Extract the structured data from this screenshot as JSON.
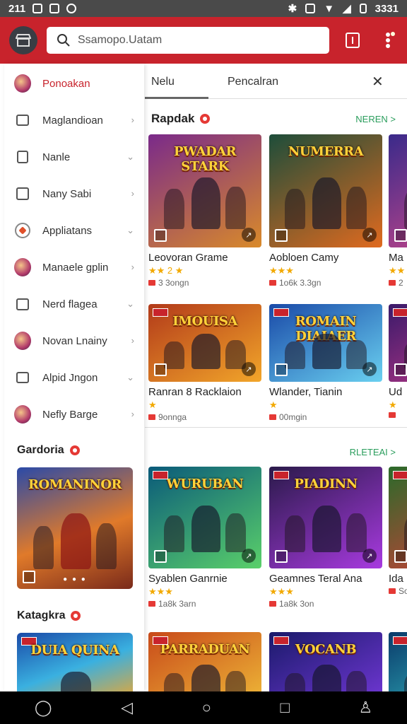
{
  "status_bar": {
    "time": "211",
    "right_text": "3331"
  },
  "app_bar": {
    "search_text": "Ssamopo.Uatam"
  },
  "drawer": {
    "items": [
      {
        "label": "Ponoakan",
        "icon": "avatar-icon"
      },
      {
        "label": "Maglandioan",
        "icon": "folder-icon"
      },
      {
        "label": "Nanle",
        "icon": "grid-icon"
      },
      {
        "label": "Nany Sabi",
        "icon": "edit-icon"
      },
      {
        "label": "Appliatans",
        "icon": "app-icon"
      },
      {
        "label": "Manaele gplin",
        "icon": "avatar-icon"
      },
      {
        "label": "Nerd flagea",
        "icon": "flag-icon"
      },
      {
        "label": "Novan Lnainy",
        "icon": "avatar-icon"
      },
      {
        "label": "Alpid Jngon",
        "icon": "card-icon"
      },
      {
        "label": "Nefly Barge",
        "icon": "avatar-icon"
      }
    ],
    "section1_title": "Gardoria",
    "section1_card_title": "ROMANINOR",
    "section2_title": "Katagkra",
    "section2_card_title": "DUIA QUINA"
  },
  "tabs": {
    "tab1": "Nelu",
    "tab2": "Pencalran"
  },
  "row1": {
    "title": "Rapdak",
    "more": "NEREN >",
    "cards": [
      {
        "art_title": "PWADAR STARK",
        "name": "Leovoran Grame",
        "stars": "★★ 2 ★",
        "meta": "3 3ongn",
        "colors": [
          "#7a2a8a",
          "#d98a2a"
        ]
      },
      {
        "art_title": "NUMERRA",
        "name": "Aobloen Camy",
        "stars": "★★★",
        "meta": "1o6k 3.3gn",
        "colors": [
          "#1d4d3a",
          "#e06a1f"
        ]
      },
      {
        "art_title": "",
        "name": "Ma",
        "stars": "★★",
        "meta": "2",
        "colors": [
          "#3a2a8a",
          "#d84a8a"
        ]
      }
    ]
  },
  "row2": {
    "cards": [
      {
        "art_title": "IMOUISA",
        "name": "Ranran 8 Racklaion",
        "stars": "★",
        "meta": "9onnga",
        "colors": [
          "#b23a1a",
          "#f2a62a"
        ]
      },
      {
        "art_title": "ROMAIN DIAIAER",
        "name": "Wlander, Tianin",
        "stars": "★",
        "meta": "00mgin",
        "colors": [
          "#1a4aa8",
          "#6ad0f0"
        ]
      },
      {
        "art_title": "",
        "name": "Ud",
        "stars": "★",
        "meta": "",
        "colors": [
          "#3a1a6a",
          "#c83a8a"
        ]
      }
    ]
  },
  "row3": {
    "more": "RLETEAI >",
    "cards": [
      {
        "art_title": "WURUBAN",
        "name": "Syablen Ganrnie",
        "stars": "★★★",
        "meta": "1a8k 3arn",
        "colors": [
          "#0a5a7a",
          "#5ad06a"
        ]
      },
      {
        "art_title": "PIADINN",
        "name": "Geamnes Teral Ana",
        "stars": "★★★",
        "meta": "1a8k 3on",
        "colors": [
          "#2a1a4a",
          "#a83ae0"
        ]
      },
      {
        "art_title": "",
        "name": "Ida",
        "stars": "",
        "meta": "Soo",
        "colors": [
          "#2a6a2a",
          "#e03a3a"
        ]
      }
    ]
  },
  "row4": {
    "cards": [
      {
        "art_title": "PARRADUAN",
        "name": "",
        "colors": [
          "#c84a1a",
          "#f2c23a"
        ]
      },
      {
        "art_title": "VOCANB",
        "name": "",
        "colors": [
          "#1a1a6a",
          "#7a3ae0"
        ]
      },
      {
        "art_title": "",
        "name": "",
        "colors": [
          "#0a3a6a",
          "#3ad0d0"
        ]
      }
    ]
  }
}
